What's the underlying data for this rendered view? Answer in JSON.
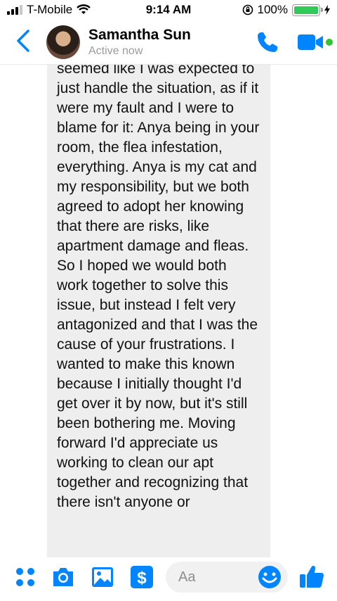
{
  "status_bar": {
    "carrier": "T-Mobile",
    "time": "9:14 AM",
    "battery": "100%",
    "battery_level": 1.0
  },
  "header": {
    "contact_name": "Samantha Sun",
    "contact_status": "Active now"
  },
  "message": {
    "text": "seemed like I was expected to just handle the situation, as if it were my fault and I were to blame for it: Anya being in your room, the flea infestation, everything. Anya is my cat and my responsibility, but we both agreed to adopt her knowing that there are risks, like apartment damage and fleas. So I hoped we would both work together to solve this issue, but instead I felt very antagonized and that I was the cause of your frustrations. I wanted to make this known because I initially thought I'd get over it by now, but it's still been bothering me. Moving forward I'd appreciate us working to clean our apt together and recognizing that there isn't anyone or"
  },
  "composer": {
    "placeholder": "Aa"
  },
  "colors": {
    "accent": "#0084ff",
    "bubble": "#eeeeef",
    "online": "#31c631"
  }
}
